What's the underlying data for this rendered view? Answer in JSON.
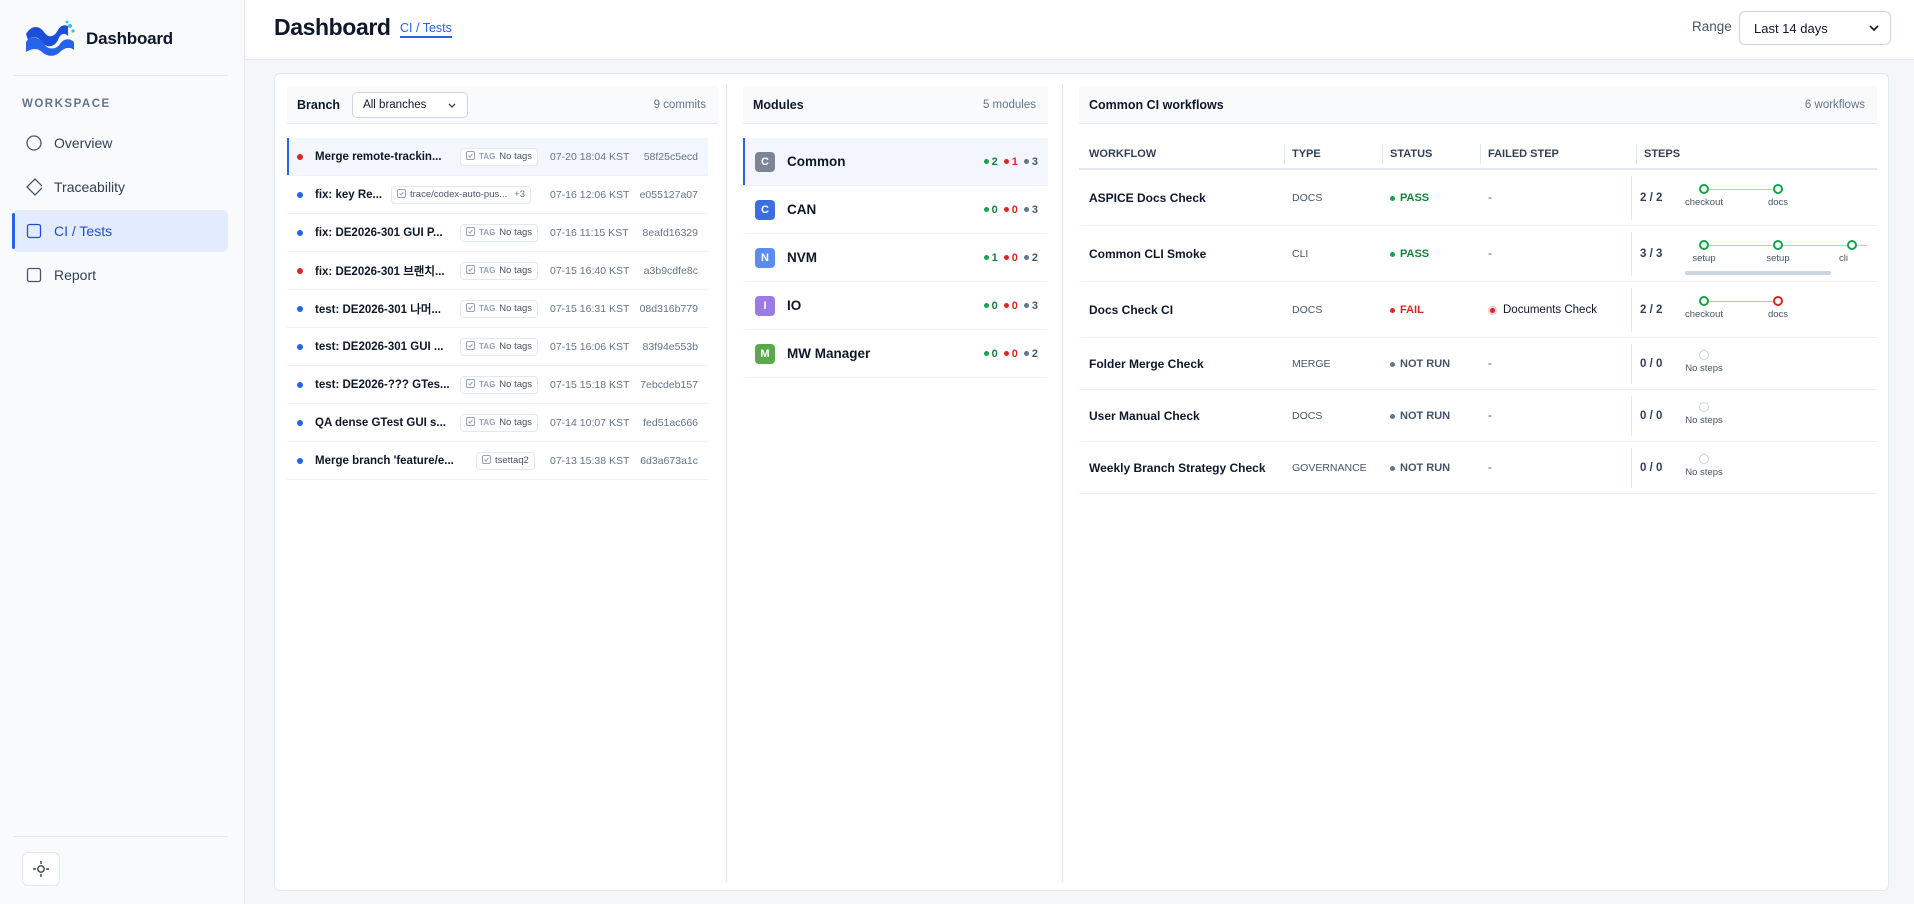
{
  "sidebar": {
    "brand": "Dashboard",
    "section": "WORKSPACE",
    "items": [
      {
        "label": "Overview",
        "icon": "circle-icon"
      },
      {
        "label": "Traceability",
        "icon": "diamond-icon"
      },
      {
        "label": "CI / Tests",
        "icon": "square-icon",
        "active": true
      },
      {
        "label": "Report",
        "icon": "square-icon"
      }
    ],
    "settings_icon": "gear-icon"
  },
  "header": {
    "title": "Dashboard",
    "breadcrumb": "CI / Tests",
    "range_label": "Range",
    "range_value": "Last 14 days"
  },
  "commits": {
    "label": "Branch",
    "branch_value": "All branches",
    "count": "9 commits",
    "items": [
      {
        "message": "Merge remote-trackin...",
        "tag_kind": "TAG",
        "tag": "No tags",
        "time": "07-20 18:04 KST",
        "hash": "58f25c5ecd",
        "status": "red"
      },
      {
        "message": "fix: key Re...",
        "tag_kind": "",
        "tag": "trace/codex-auto-pus...",
        "tag_extra": "+3",
        "time": "07-16 12:06 KST",
        "hash": "e055127a07",
        "status": "blue"
      },
      {
        "message": "fix: DE2026-301 GUI P...",
        "tag_kind": "TAG",
        "tag": "No tags",
        "time": "07-16 11:15 KST",
        "hash": "8eafd16329",
        "status": "blue"
      },
      {
        "message": "fix: DE2026-301 브랜치...",
        "tag_kind": "TAG",
        "tag": "No tags",
        "time": "07-15 16:40 KST",
        "hash": "a3b9cdfe8c",
        "status": "red"
      },
      {
        "message": "test: DE2026-301 나머...",
        "tag_kind": "TAG",
        "tag": "No tags",
        "time": "07-15 16:31 KST",
        "hash": "08d316b779",
        "status": "blue"
      },
      {
        "message": "test: DE2026-301 GUI ...",
        "tag_kind": "TAG",
        "tag": "No tags",
        "time": "07-15 16:06 KST",
        "hash": "83f94e553b",
        "status": "blue"
      },
      {
        "message": "test: DE2026-??? GTes...",
        "tag_kind": "TAG",
        "tag": "No tags",
        "time": "07-15 15:18 KST",
        "hash": "7ebcdeb157",
        "status": "blue"
      },
      {
        "message": "QA dense GTest GUI s...",
        "tag_kind": "TAG",
        "tag": "No tags",
        "time": "07-14 10:07 KST",
        "hash": "fed51ac666",
        "status": "blue"
      },
      {
        "message": "Merge branch 'feature/e...",
        "tag_kind": "",
        "tag": "tsettaq2",
        "time": "07-13 15:38 KST",
        "hash": "6d3a673a1c",
        "status": "blue"
      }
    ]
  },
  "modules": {
    "title": "Modules",
    "count": "5 modules",
    "items": [
      {
        "letter": "C",
        "name": "Common",
        "pass": "2",
        "fail": "1",
        "other": "3",
        "color": "#7c8595"
      },
      {
        "letter": "C",
        "name": "CAN",
        "pass": "0",
        "fail": "0",
        "other": "3",
        "color": "#3b6fe0"
      },
      {
        "letter": "N",
        "name": "NVM",
        "pass": "1",
        "fail": "0",
        "other": "2",
        "color": "#5b8def"
      },
      {
        "letter": "I",
        "name": "IO",
        "pass": "0",
        "fail": "0",
        "other": "3",
        "color": "#9b7be6"
      },
      {
        "letter": "M",
        "name": "MW Manager",
        "pass": "0",
        "fail": "0",
        "other": "2",
        "color": "#5aa84a"
      }
    ]
  },
  "workflows": {
    "title": "Common CI workflows",
    "count": "6 workflows",
    "columns": [
      "WORKFLOW",
      "TYPE",
      "STATUS",
      "FAILED STEP",
      "STEPS"
    ],
    "rows": [
      {
        "name": "ASPICE Docs Check",
        "type": "DOCS",
        "status": "PASS",
        "failed": "-",
        "steps": "2 / 2",
        "nodes": [
          {
            "label": "checkout",
            "state": "ok"
          },
          {
            "label": "docs",
            "state": "ok"
          }
        ]
      },
      {
        "name": "Common CLI Smoke",
        "type": "CLI",
        "status": "PASS",
        "failed": "-",
        "steps": "3 / 3",
        "nodes": [
          {
            "label": "setup",
            "state": "ok"
          },
          {
            "label": "setup",
            "state": "ok"
          },
          {
            "label": "cli",
            "state": "ok"
          }
        ]
      },
      {
        "name": "Docs Check CI",
        "type": "DOCS",
        "status": "FAIL",
        "failed": "Documents Check",
        "steps": "2 / 2",
        "nodes": [
          {
            "label": "checkout",
            "state": "ok"
          },
          {
            "label": "docs",
            "state": "bad"
          }
        ]
      },
      {
        "name": "Folder Merge Check",
        "type": "MERGE",
        "status": "NOT RUN",
        "failed": "-",
        "steps": "0 / 0",
        "empty": "No steps"
      },
      {
        "name": "User Manual Check",
        "type": "DOCS",
        "status": "NOT RUN",
        "failed": "-",
        "steps": "0 / 0",
        "empty": "No steps"
      },
      {
        "name": "Weekly Branch Strategy Check",
        "type": "GOVERNANCE",
        "status": "NOT RUN",
        "failed": "-",
        "steps": "0 / 0",
        "empty": "No steps"
      }
    ]
  },
  "colors": {
    "accent": "#2563eb",
    "pass": "#16a34a",
    "fail": "#dc2626",
    "neutral": "#64748b"
  }
}
